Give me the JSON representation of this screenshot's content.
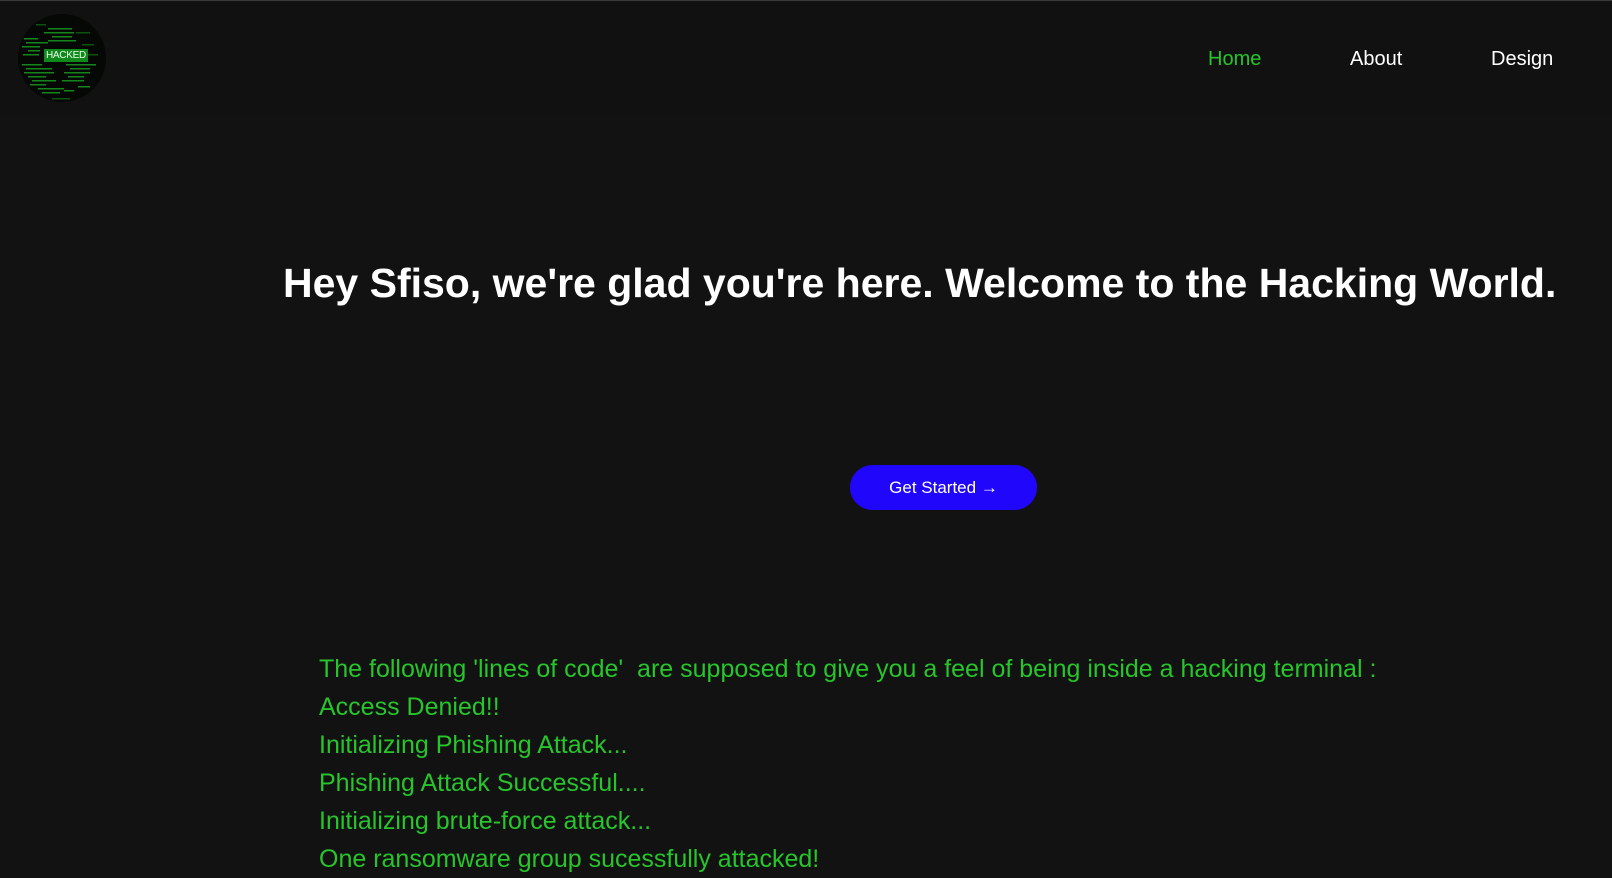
{
  "logo": {
    "text": "HACKED",
    "icon": "hacked-matrix-logo",
    "color": "#27c52b"
  },
  "nav": {
    "items": [
      {
        "label": "Home",
        "active": true
      },
      {
        "label": "About",
        "active": false
      },
      {
        "label": "Design",
        "active": false
      }
    ]
  },
  "hero": {
    "title": "Hey Sfiso, we're glad you're here. Welcome to the Hacking World.",
    "cta_label": "Get Started →"
  },
  "terminal": {
    "lines": [
      "The following 'lines of code'  are supposed to give you a feel of being inside a hacking terminal :",
      "Access Denied!!",
      "Initializing Phishing Attack...",
      "Phishing Attack Successful....",
      "Initializing brute-force attack...",
      "One ransomware group sucessfully attacked!"
    ]
  },
  "colors": {
    "background": "#131212",
    "accent_green": "#27c52b",
    "button_blue": "#2007fb",
    "text_white": "#ffffff"
  }
}
